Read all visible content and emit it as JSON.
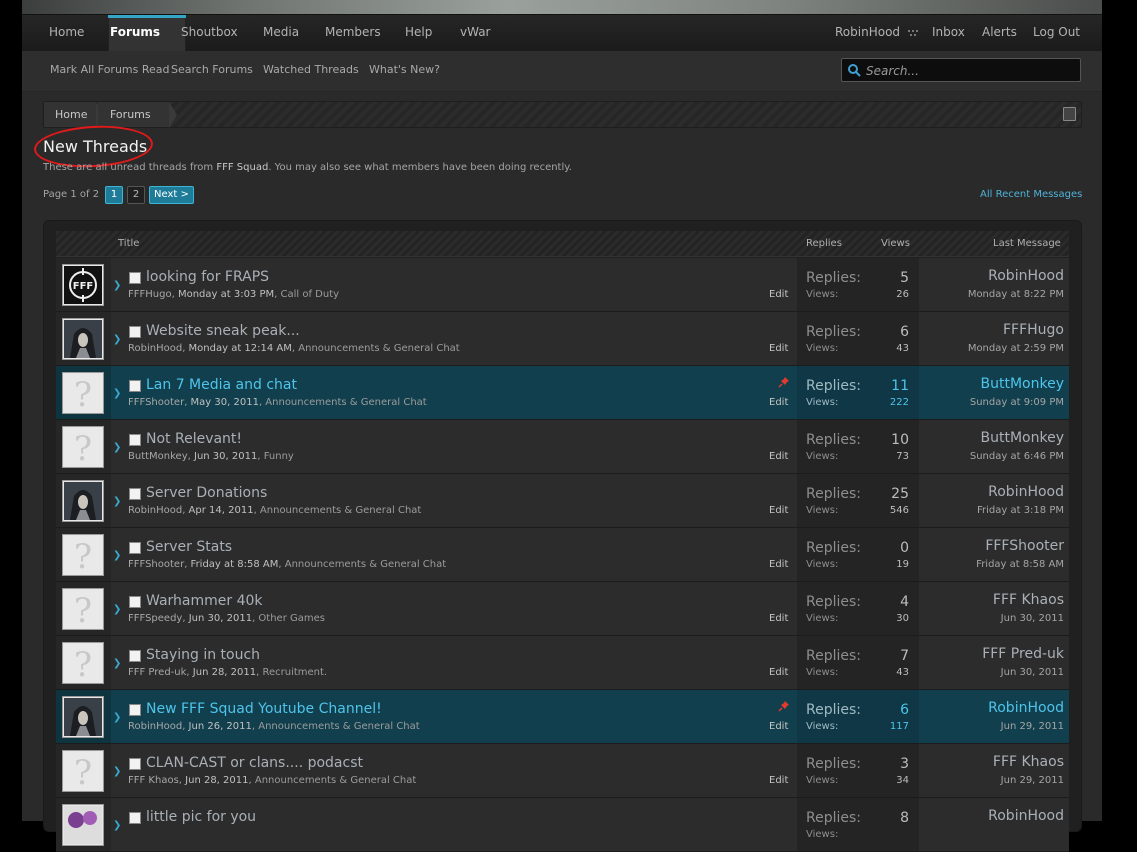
{
  "nav": {
    "items": [
      {
        "label": "Home"
      },
      {
        "label": "Forums"
      },
      {
        "label": "Shoutbox"
      },
      {
        "label": "Media"
      },
      {
        "label": "Members"
      },
      {
        "label": "Help"
      },
      {
        "label": "vWar"
      }
    ],
    "user": "RobinHood",
    "inbox": "Inbox",
    "alerts": "Alerts",
    "logout": "Log Out",
    "active_color": "#34a7c7"
  },
  "subnav": {
    "items": [
      {
        "label": "Mark All Forums Read"
      },
      {
        "label": "Search Forums"
      },
      {
        "label": "Watched Threads"
      },
      {
        "label": "What's New?"
      }
    ],
    "search_placeholder": "Search..."
  },
  "breadcrumb": [
    {
      "label": "Home"
    },
    {
      "label": "Forums"
    }
  ],
  "page": {
    "title": "New Threads",
    "desc_prefix": "These are all unread threads from ",
    "desc_site": "FFF Squad",
    "desc_suffix": ". You may also see what members have been doing recently.",
    "pagination_label": "Page 1 of 2",
    "pages": [
      "1",
      "2"
    ],
    "next": "Next >",
    "recent": "All Recent Messages"
  },
  "table": {
    "headers": {
      "title": "Title",
      "replies": "Replies",
      "views": "Views",
      "last": "Last Message"
    },
    "replies_label": "Replies:",
    "views_label": "Views:",
    "edit_label": "Edit",
    "rows": [
      {
        "title": "looking for FRAPS",
        "author": "FFFHugo",
        "date": "Monday at 3:03 PM",
        "forum": "Call of Duty",
        "replies": "5",
        "views": "26",
        "last_user": "RobinHood",
        "last_date": "Monday at 8:22 PM",
        "sticky": false,
        "avatar": "logo"
      },
      {
        "title": "Website sneak peak...",
        "author": "RobinHood",
        "date": "Monday at 12:14 AM",
        "forum": "Announcements & General Chat",
        "replies": "6",
        "views": "43",
        "last_user": "FFFHugo",
        "last_date": "Monday at 2:59 PM",
        "sticky": false,
        "avatar": "hood"
      },
      {
        "title": "Lan 7 Media and chat",
        "author": "FFFShooter",
        "date": "May 30, 2011",
        "forum": "Announcements & General Chat",
        "replies": "11",
        "views": "222",
        "last_user": "ButtMonkey",
        "last_date": "Sunday at 9:09 PM",
        "sticky": true,
        "avatar": "default"
      },
      {
        "title": "Not Relevant!",
        "author": "ButtMonkey",
        "date": "Jun 30, 2011",
        "forum": "Funny",
        "replies": "10",
        "views": "73",
        "last_user": "ButtMonkey",
        "last_date": "Sunday at 6:46 PM",
        "sticky": false,
        "avatar": "default"
      },
      {
        "title": "Server Donations",
        "author": "RobinHood",
        "date": "Apr 14, 2011",
        "forum": "Announcements & General Chat",
        "replies": "25",
        "views": "546",
        "last_user": "RobinHood",
        "last_date": "Friday at 3:18 PM",
        "sticky": false,
        "avatar": "hood"
      },
      {
        "title": "Server Stats",
        "author": "FFFShooter",
        "date": "Friday at 8:58 AM",
        "forum": "Announcements & General Chat",
        "replies": "0",
        "views": "19",
        "last_user": "FFFShooter",
        "last_date": "Friday at 8:58 AM",
        "sticky": false,
        "avatar": "default"
      },
      {
        "title": "Warhammer 40k",
        "author": "FFFSpeedy",
        "date": "Jun 30, 2011",
        "forum": "Other Games",
        "replies": "4",
        "views": "30",
        "last_user": "FFF Khaos",
        "last_date": "Jun 30, 2011",
        "sticky": false,
        "avatar": "default"
      },
      {
        "title": "Staying in touch",
        "author": "FFF Pred-uk",
        "date": "Jun 28, 2011",
        "forum": "Recruitment.",
        "replies": "7",
        "views": "43",
        "last_user": "FFF Pred-uk",
        "last_date": "Jun 30, 2011",
        "sticky": false,
        "avatar": "default"
      },
      {
        "title": "New FFF Squad Youtube Channel!",
        "author": "RobinHood",
        "date": "Jun 26, 2011",
        "forum": "Announcements & General Chat",
        "replies": "6",
        "views": "117",
        "last_user": "RobinHood",
        "last_date": "Jun 29, 2011",
        "sticky": true,
        "avatar": "hood"
      },
      {
        "title": "CLAN-CAST or clans.... podacst",
        "author": "FFF Khaos",
        "date": "Jun 28, 2011",
        "forum": "Announcements & General Chat",
        "replies": "3",
        "views": "34",
        "last_user": "FFF Khaos",
        "last_date": "Jun 29, 2011",
        "sticky": false,
        "avatar": "default"
      },
      {
        "title": "little pic for you",
        "author": "",
        "date": "",
        "forum": "",
        "replies": "8",
        "views": "",
        "last_user": "RobinHood",
        "last_date": "",
        "sticky": false,
        "avatar": "purple"
      }
    ]
  }
}
